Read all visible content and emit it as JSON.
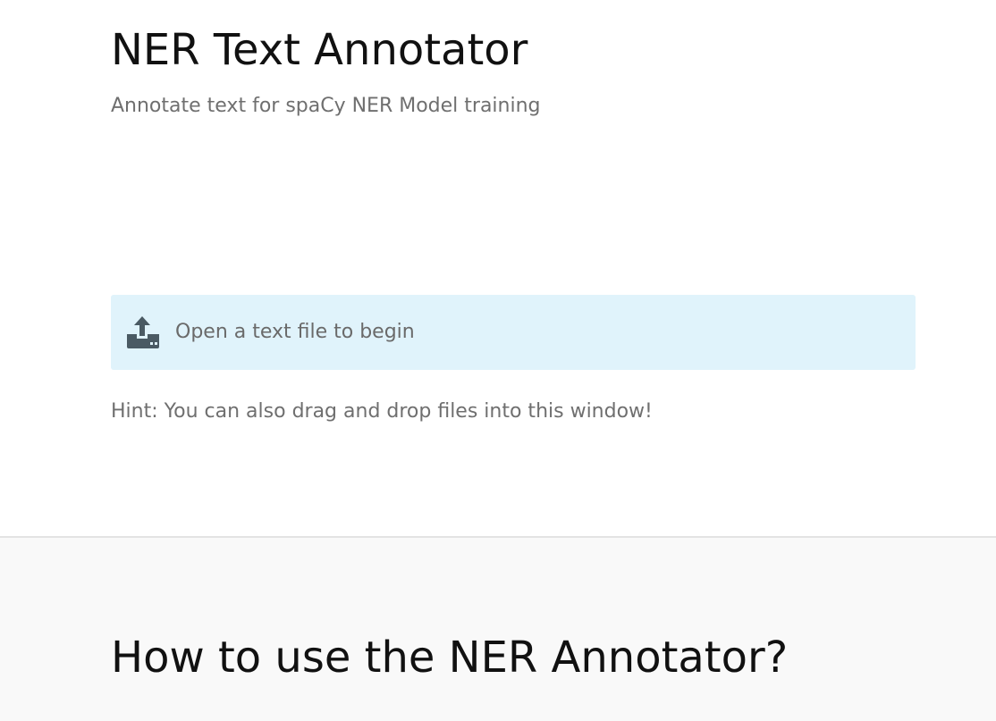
{
  "header": {
    "title": "NER Text Annotator",
    "subtitle": "Annotate text for spaCy NER Model training"
  },
  "open_file": {
    "icon": "upload-icon",
    "label": "Open a text file to begin",
    "background": "#e0f3fb"
  },
  "hint": "Hint: You can also drag and drop files into this window!",
  "howto": {
    "title": "How to use the NER Annotator?",
    "background": "#f9f9f9"
  }
}
